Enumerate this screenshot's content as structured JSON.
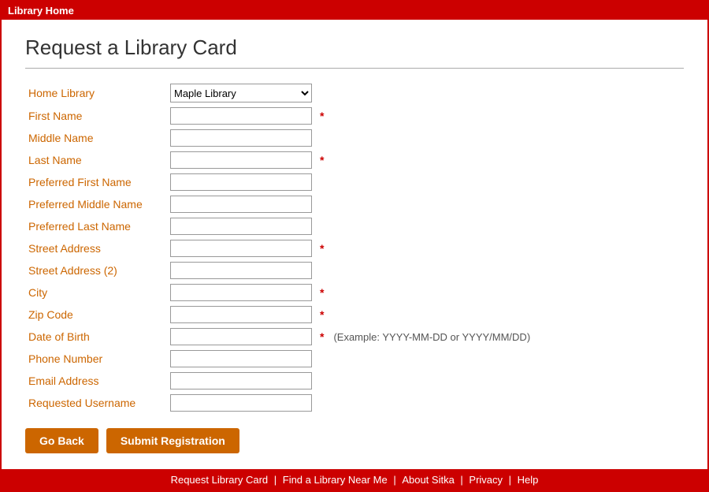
{
  "titleBar": {
    "label": "Library Home"
  },
  "page": {
    "heading": "Request a Library Card"
  },
  "form": {
    "fields": [
      {
        "id": "home-library",
        "label": "Home Library",
        "type": "select",
        "required": false,
        "options": [
          "Maple Library"
        ],
        "selected": "Maple Library"
      },
      {
        "id": "first-name",
        "label": "First Name",
        "type": "text",
        "required": true
      },
      {
        "id": "middle-name",
        "label": "Middle Name",
        "type": "text",
        "required": false
      },
      {
        "id": "last-name",
        "label": "Last Name",
        "type": "text",
        "required": true
      },
      {
        "id": "preferred-first-name",
        "label": "Preferred First Name",
        "type": "text",
        "required": false
      },
      {
        "id": "preferred-middle-name",
        "label": "Preferred Middle Name",
        "type": "text",
        "required": false
      },
      {
        "id": "preferred-last-name",
        "label": "Preferred Last Name",
        "type": "text",
        "required": false
      },
      {
        "id": "street-address",
        "label": "Street Address",
        "type": "text",
        "required": true
      },
      {
        "id": "street-address-2",
        "label": "Street Address (2)",
        "type": "text",
        "required": false
      },
      {
        "id": "city",
        "label": "City",
        "type": "text",
        "required": true
      },
      {
        "id": "zip-code",
        "label": "Zip Code",
        "type": "text",
        "required": true
      },
      {
        "id": "date-of-birth",
        "label": "Date of Birth",
        "type": "text",
        "required": true,
        "hint": "(Example: YYYY-MM-DD or YYYY/MM/DD)"
      },
      {
        "id": "phone-number",
        "label": "Phone Number",
        "type": "text",
        "required": false
      },
      {
        "id": "email-address",
        "label": "Email Address",
        "type": "text",
        "required": false
      },
      {
        "id": "requested-username",
        "label": "Requested Username",
        "type": "text",
        "required": false
      }
    ],
    "buttons": {
      "back": "Go Back",
      "submit": "Submit Registration"
    }
  },
  "footer": {
    "links": [
      "Request Library Card",
      "Find a Library Near Me",
      "About Sitka",
      "Privacy",
      "Help"
    ]
  }
}
